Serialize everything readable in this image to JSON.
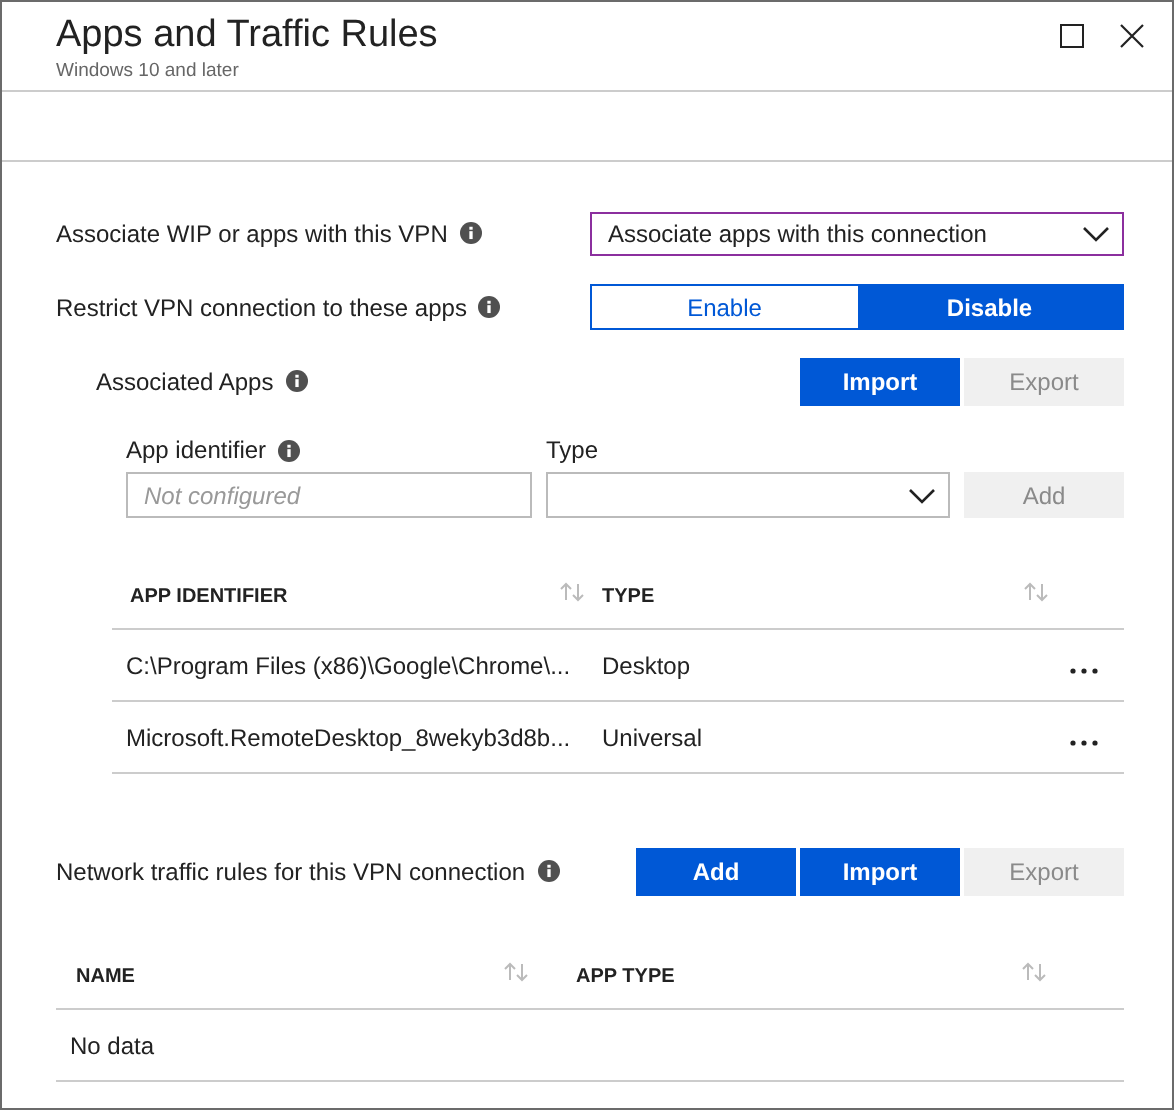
{
  "window": {
    "title": "Apps and Traffic Rules",
    "subtitle": "Windows 10 and later"
  },
  "settings": [
    {
      "kind": "dropdown",
      "label": "Associate WIP or apps with this VPN",
      "value": "Associate apps with this connection"
    },
    {
      "kind": "toggle",
      "label": "Restrict VPN connection to these apps",
      "options": [
        {
          "label": "Enable",
          "selected": false
        },
        {
          "label": "Disable",
          "selected": true
        }
      ]
    }
  ],
  "associated_apps": {
    "label": "Associated Apps",
    "buttons": [
      {
        "label": "Import",
        "disabled": false
      },
      {
        "label": "Export",
        "disabled": true
      }
    ],
    "app_identifier": {
      "label": "App identifier",
      "placeholder": "Not configured"
    },
    "type": {
      "label": "Type"
    },
    "add_button": {
      "label": "Add",
      "disabled": true
    },
    "table": {
      "columns": [
        "APP IDENTIFIER",
        "TYPE"
      ],
      "rows": [
        {
          "app_identifier": "C:\\Program Files (x86)\\Google\\Chrome\\...",
          "type": "Desktop"
        },
        {
          "app_identifier": "Microsoft.RemoteDesktop_8wekyb3d8b...",
          "type": "Universal"
        }
      ]
    }
  },
  "traffic_rules": {
    "label": "Network traffic rules for this VPN connection",
    "buttons": [
      {
        "label": "Add",
        "disabled": false
      },
      {
        "label": "Import",
        "disabled": false
      },
      {
        "label": "Export",
        "disabled": true
      }
    ],
    "table": {
      "columns": [
        "NAME",
        "APP TYPE"
      ],
      "empty_text": "No data"
    }
  }
}
